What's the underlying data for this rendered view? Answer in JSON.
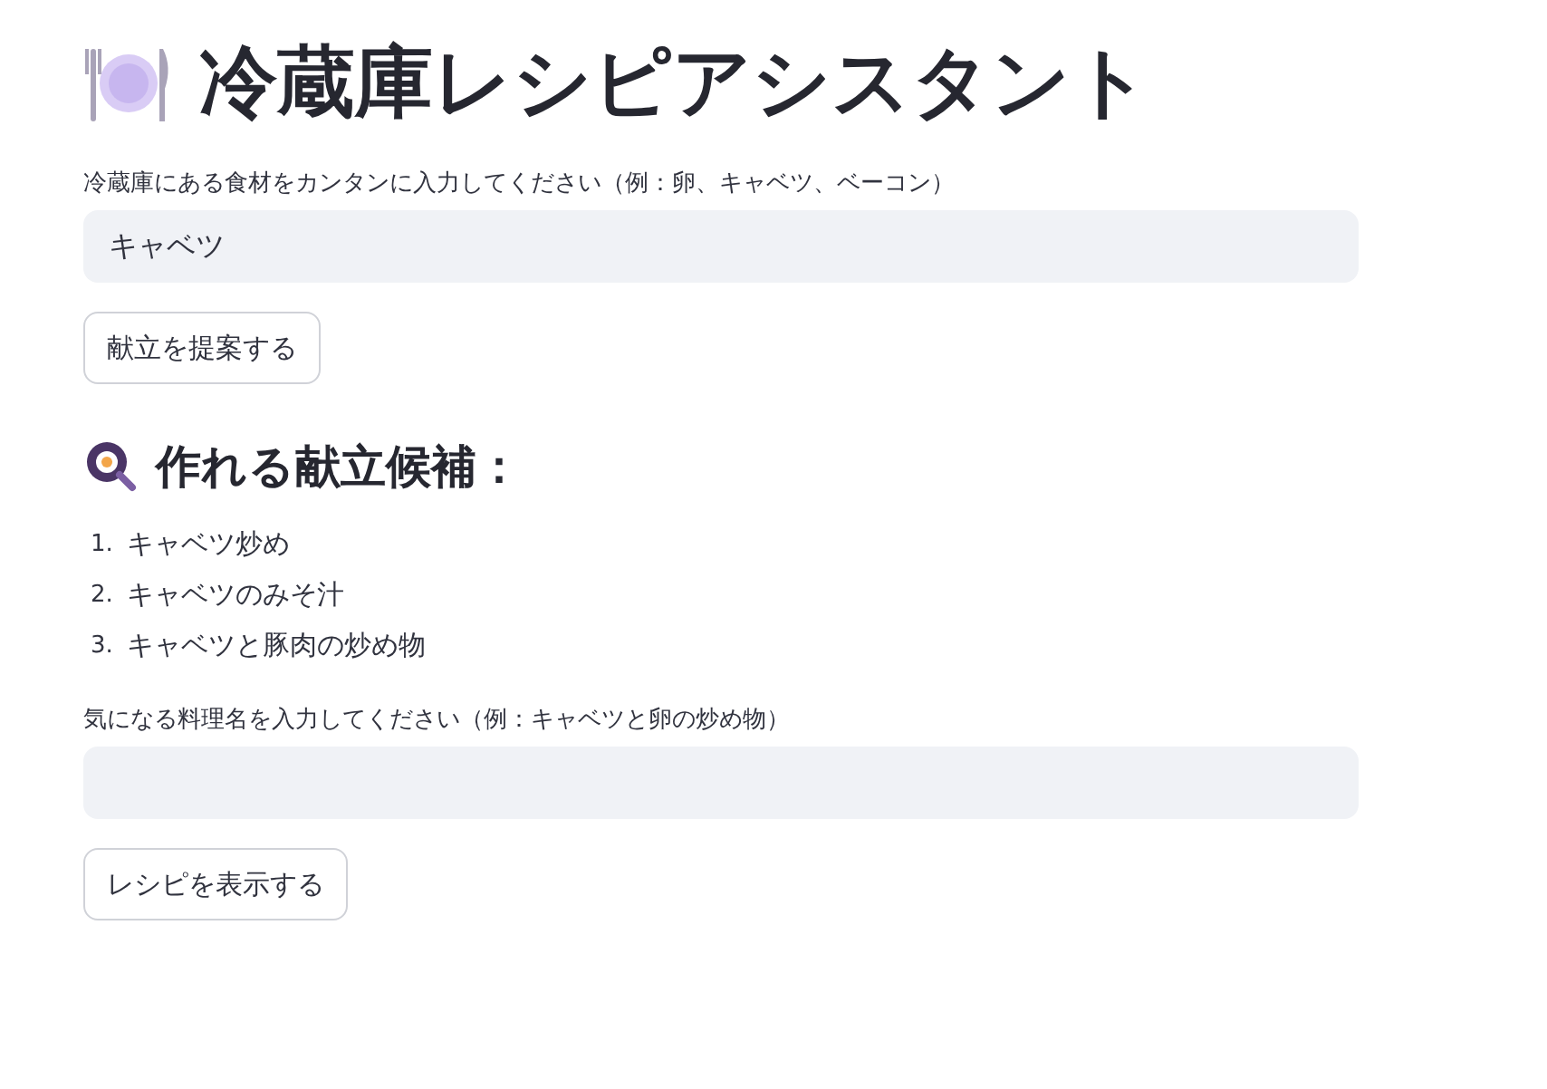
{
  "title": "冷蔵庫レシピアシスタント",
  "ingredients_field": {
    "label": "冷蔵庫にある食材をカンタンに入力してください（例：卵、キャベツ、ベーコン）",
    "value": "キャベツ"
  },
  "suggest_button": "献立を提案する",
  "candidates_heading": "作れる献立候補：",
  "candidates": [
    {
      "number": "1.",
      "text": "キャベツ炒め"
    },
    {
      "number": "2.",
      "text": "キャベツのみそ汁"
    },
    {
      "number": "3.",
      "text": "キャベツと豚肉の炒め物"
    }
  ],
  "dish_field": {
    "label": "気になる料理名を入力してください（例：キャベツと卵の炒め物）"
  },
  "recipe_button": "レシピを表示する"
}
